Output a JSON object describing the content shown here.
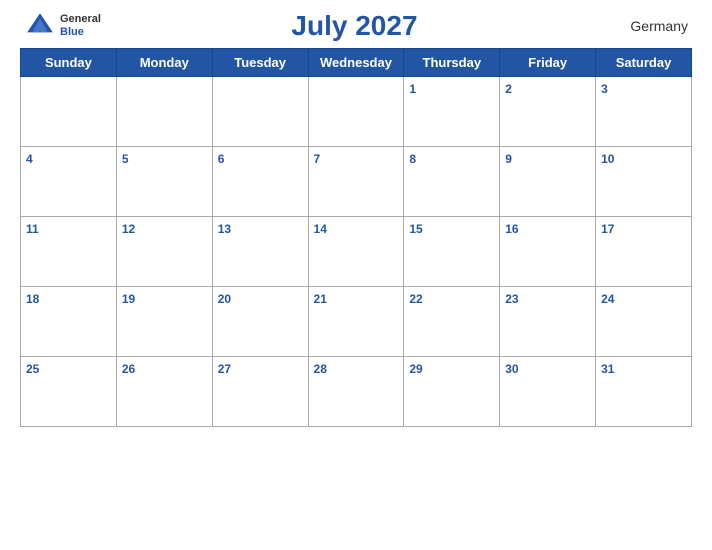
{
  "header": {
    "logo_general": "General",
    "logo_blue": "Blue",
    "title": "July 2027",
    "country": "Germany"
  },
  "weekdays": [
    "Sunday",
    "Monday",
    "Tuesday",
    "Wednesday",
    "Thursday",
    "Friday",
    "Saturday"
  ],
  "weeks": [
    [
      null,
      null,
      null,
      null,
      1,
      2,
      3
    ],
    [
      4,
      5,
      6,
      7,
      8,
      9,
      10
    ],
    [
      11,
      12,
      13,
      14,
      15,
      16,
      17
    ],
    [
      18,
      19,
      20,
      21,
      22,
      23,
      24
    ],
    [
      25,
      26,
      27,
      28,
      29,
      30,
      31
    ]
  ]
}
